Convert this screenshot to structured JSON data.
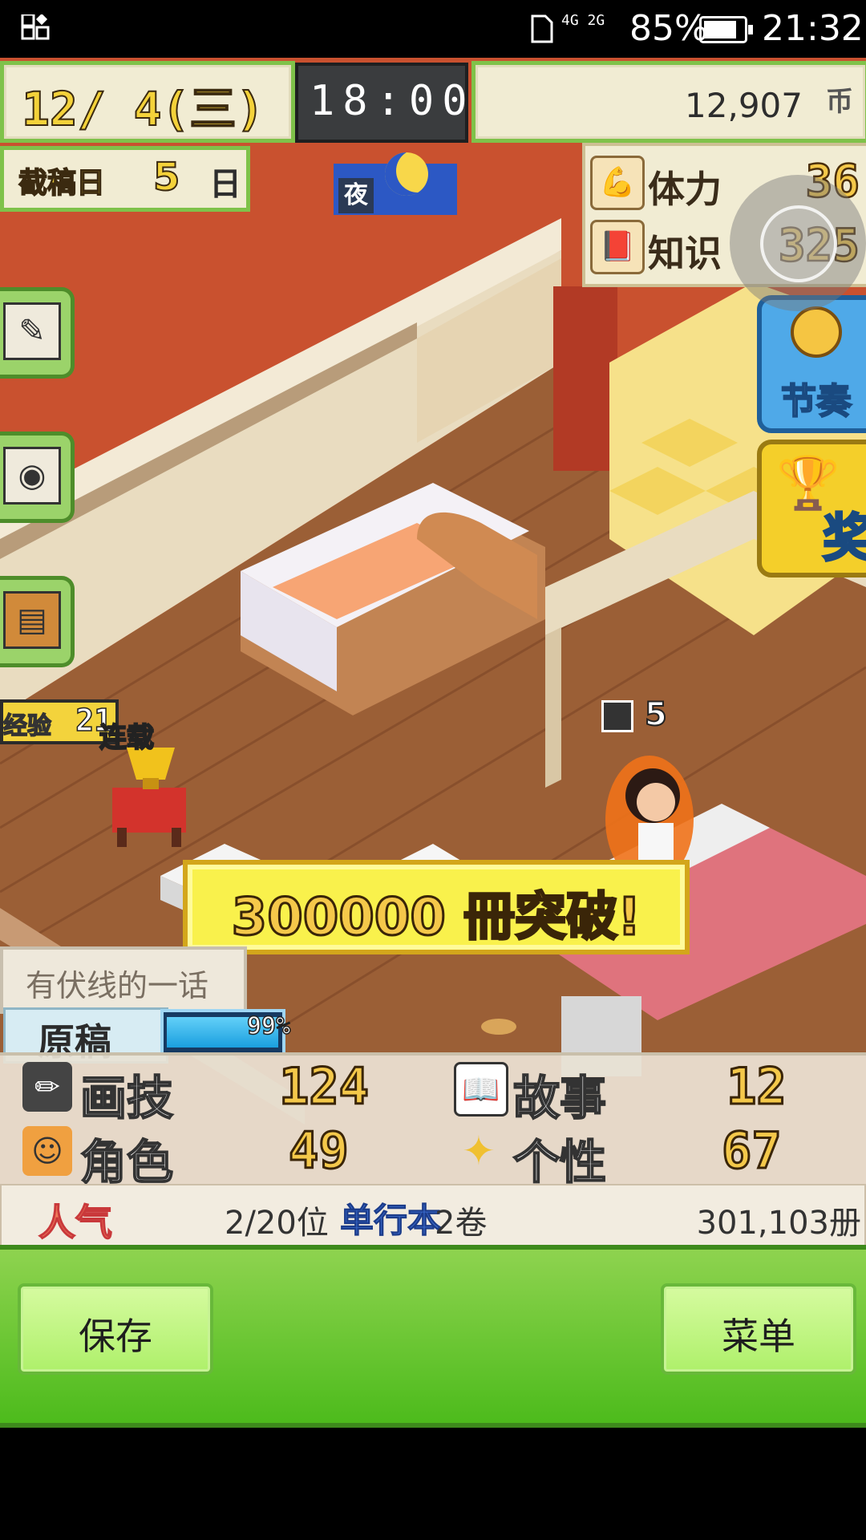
{
  "status_bar": {
    "network": "4G 2G",
    "battery_pct": "85%",
    "battery_level": 0.85,
    "clock": "21:32"
  },
  "hud": {
    "date": "12/ 4(三)",
    "time": "18:00",
    "money": "12,907",
    "money_unit": "币",
    "deadline_label": "截稿日",
    "deadline_days": "5",
    "deadline_unit": "日",
    "period": "夜"
  },
  "stats": {
    "stamina_label": "体力",
    "stamina_value": "36",
    "knowledge_label": "知识",
    "knowledge_value": "325"
  },
  "right_buttons": {
    "rhythm_label": "节奏",
    "award_label": "奖"
  },
  "scene": {
    "exp_label": "经验",
    "exp_value": "21",
    "trophy_label": "连载",
    "level_badge": "5",
    "banner": "300000 冊突破!"
  },
  "manuscript": {
    "chapter": "有伏线的一话",
    "label": "原稿",
    "progress": 0.99,
    "progress_text": "99%"
  },
  "story_stats": {
    "drawing_label": "画技",
    "drawing_value": "124",
    "story_label": "故事",
    "story_value": "12",
    "character_label": "角色",
    "character_value": "49",
    "personality_label": "个性",
    "personality_value": "67"
  },
  "popularity": {
    "label": "人气",
    "rank": "2/20位",
    "volume_label": "单行本",
    "volume": "2卷",
    "sales": "301,103册"
  },
  "bottom": {
    "save": "保存",
    "menu": "菜单"
  },
  "colors": {
    "accent_green": "#7fc24a",
    "gold": "#f4c84a",
    "wall": "#c8492f"
  }
}
